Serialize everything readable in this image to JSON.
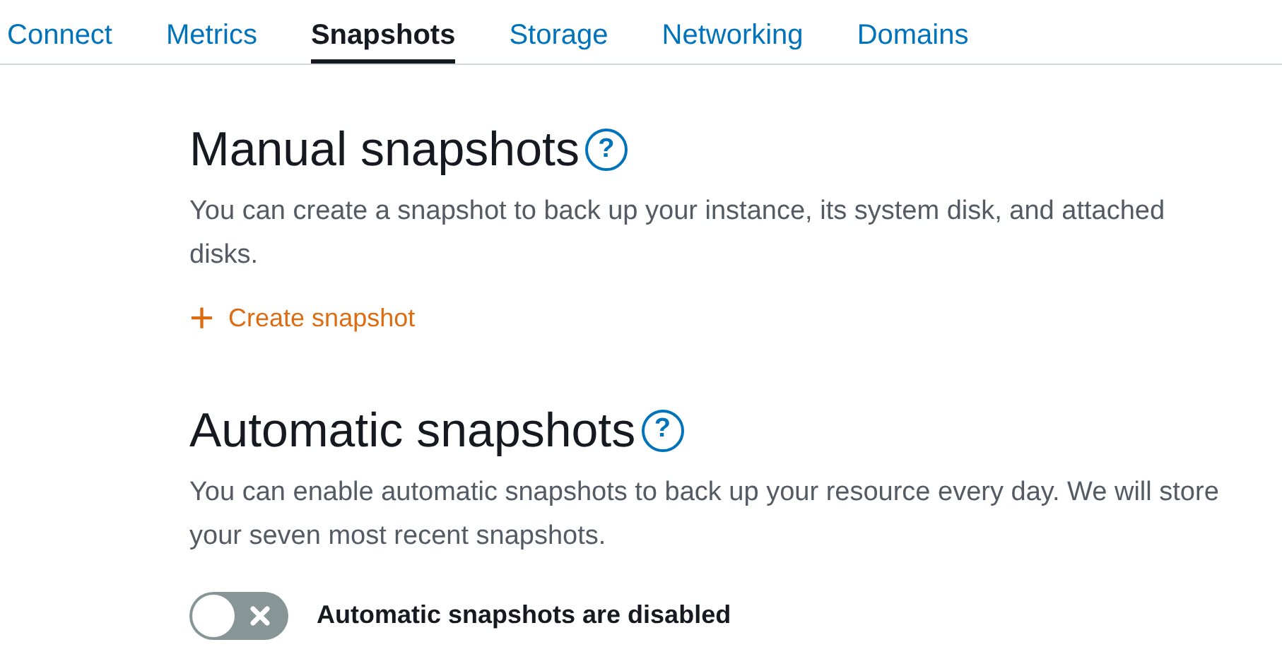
{
  "tabs": [
    {
      "label": "Connect",
      "selected": false
    },
    {
      "label": "Metrics",
      "selected": false
    },
    {
      "label": "Snapshots",
      "selected": true
    },
    {
      "label": "Storage",
      "selected": false
    },
    {
      "label": "Networking",
      "selected": false
    },
    {
      "label": "Domains",
      "selected": false
    }
  ],
  "sections": [
    {
      "kind": "action",
      "title": "Manual snapshots",
      "help": "?",
      "description": "You can create a snapshot to back up your instance, its system disk, and attached disks.",
      "action": {
        "icon": "+",
        "label": "Create snapshot"
      }
    },
    {
      "kind": "toggle",
      "title": "Automatic snapshots",
      "help": "?",
      "description": "You can enable automatic snapshots to back up your resource every day. We will store your seven most recent snapshots.",
      "toggle": {
        "on": false,
        "label": "Automatic snapshots are disabled"
      }
    }
  ]
}
